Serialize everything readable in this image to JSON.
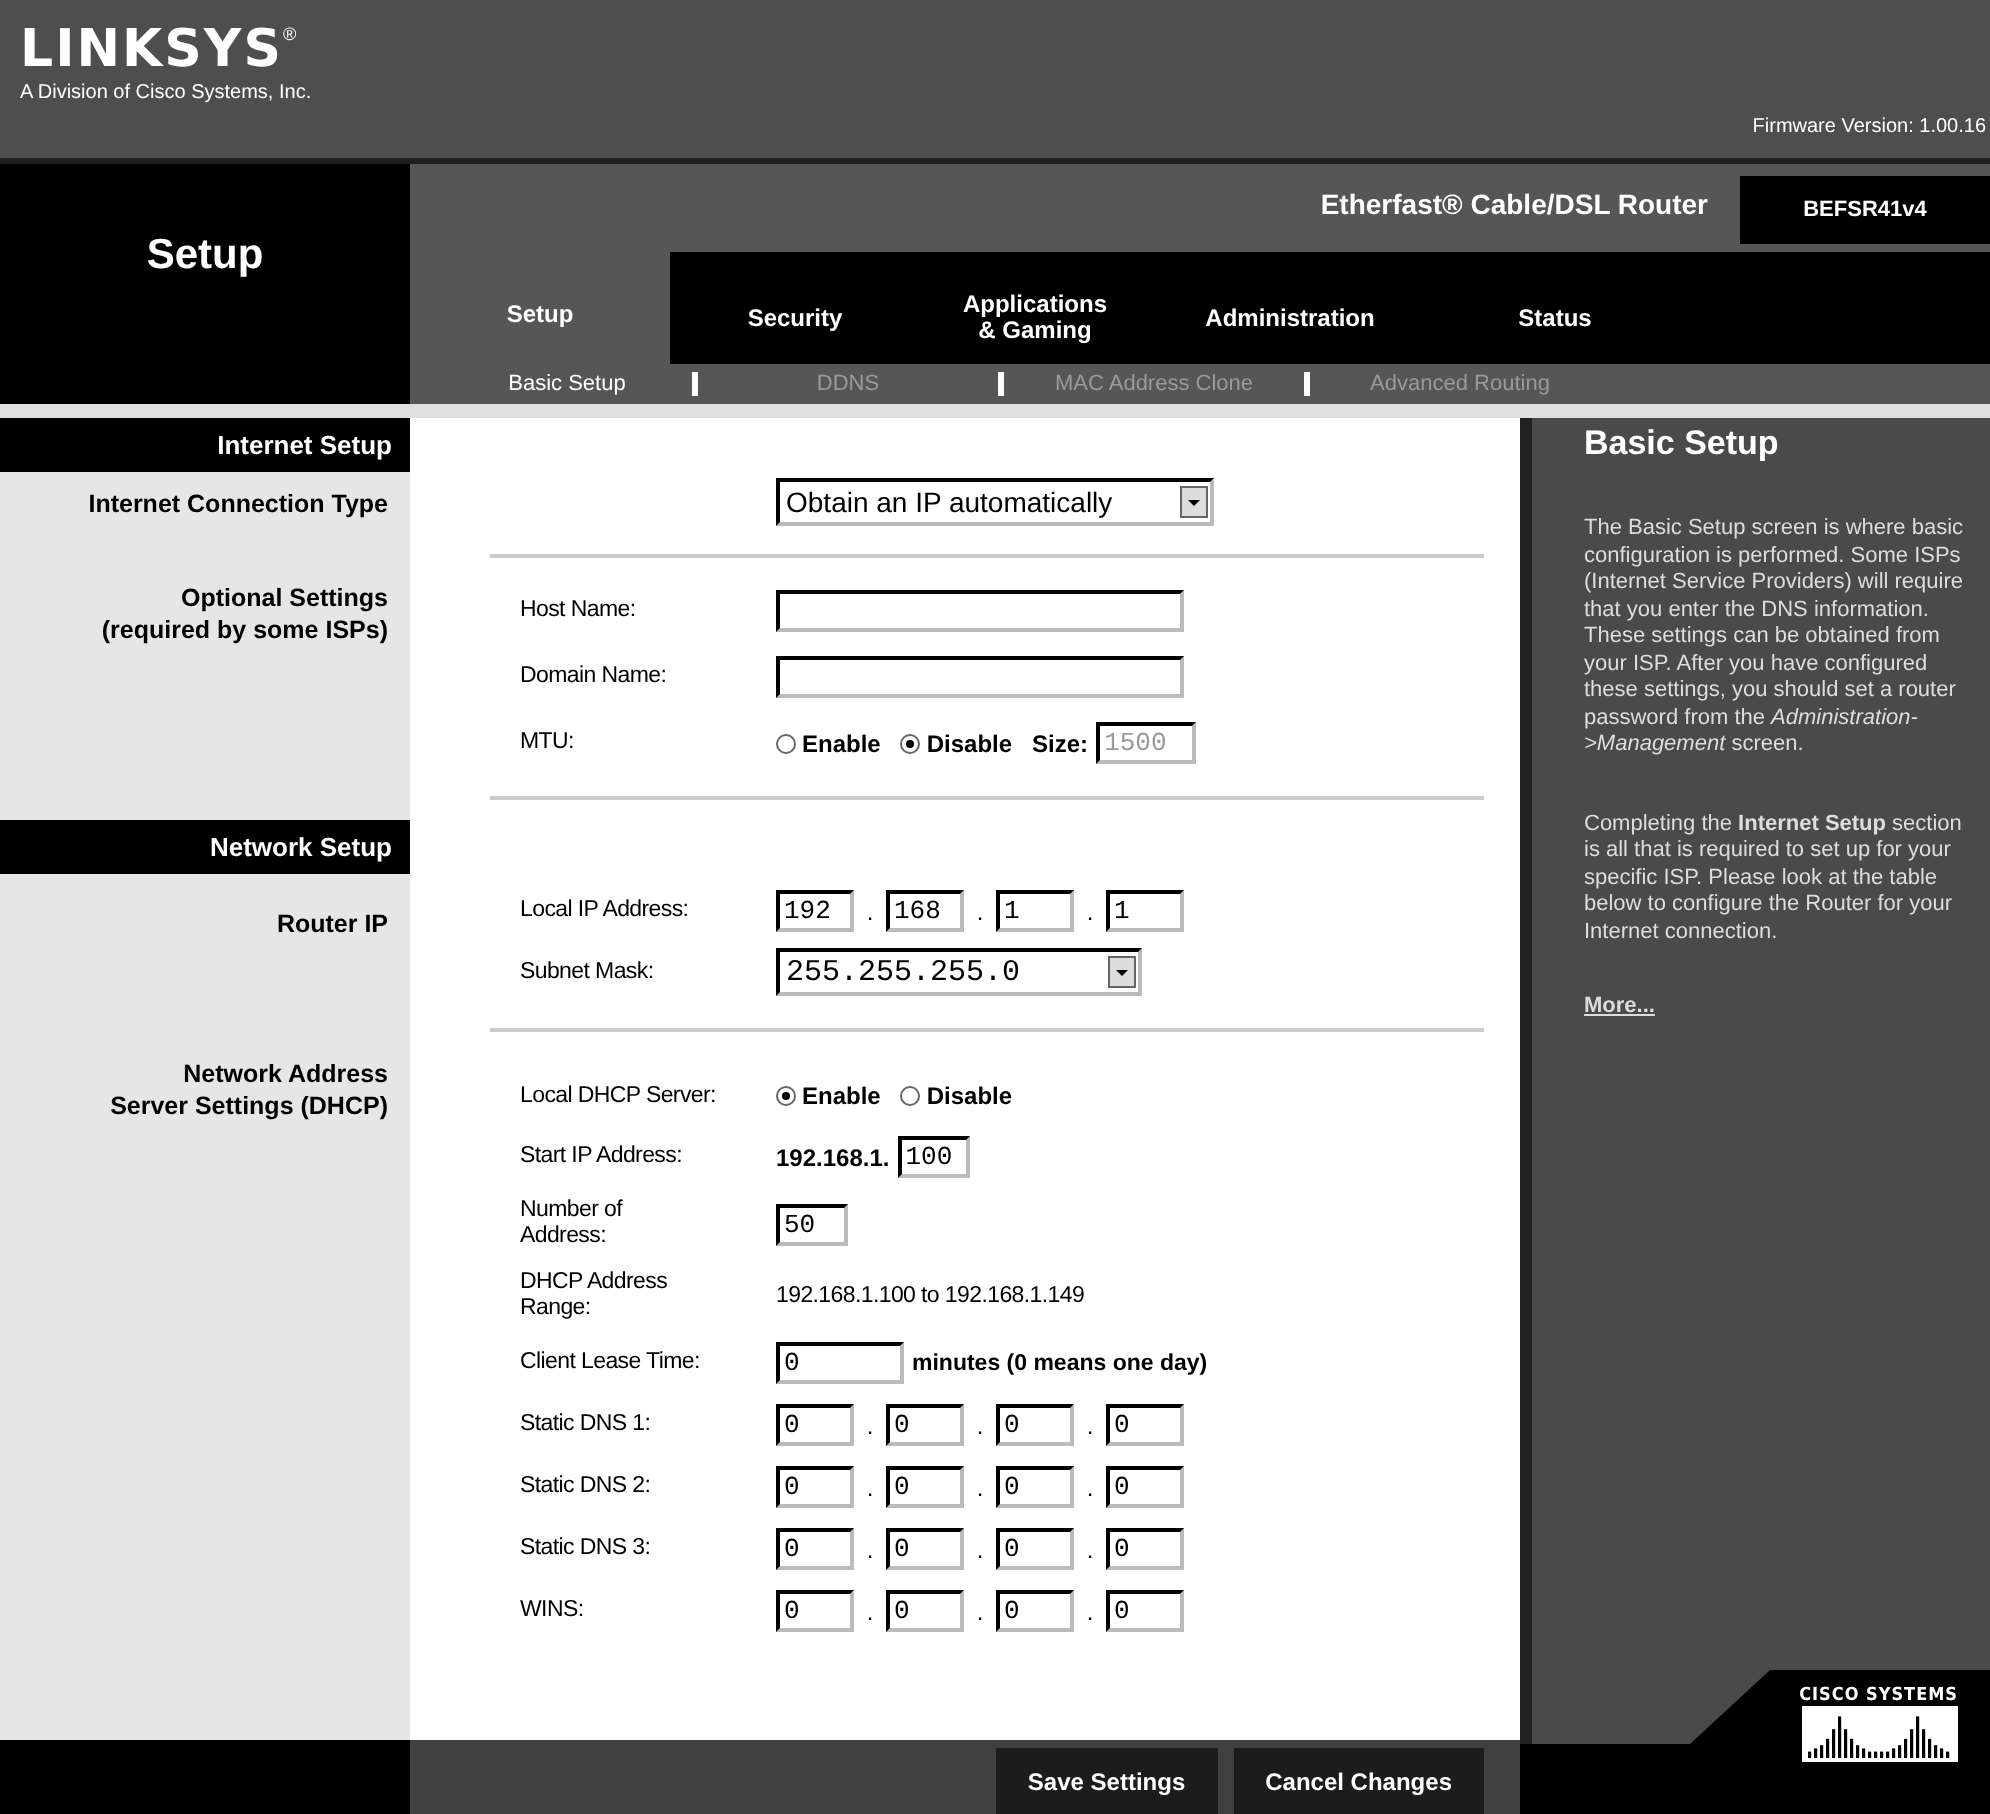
{
  "header": {
    "brand": "LINKSYS",
    "brand_mark": "®",
    "tagline": "A Division of Cisco Systems, Inc.",
    "firmware": "Firmware Version: 1.00.16"
  },
  "page_title": "Setup",
  "product": {
    "name": "Etherfast® Cable/DSL Router",
    "model": "BEFSR41v4"
  },
  "tabs": [
    {
      "label": "Setup",
      "selected": true
    },
    {
      "label": "Security",
      "selected": false
    },
    {
      "label": "Applications\n& Gaming",
      "selected": false
    },
    {
      "label": "Administration",
      "selected": false
    },
    {
      "label": "Status",
      "selected": false
    }
  ],
  "subtabs": [
    {
      "label": "Basic Setup",
      "selected": true
    },
    {
      "label": "DDNS",
      "selected": false
    },
    {
      "label": "MAC Address Clone",
      "selected": false
    },
    {
      "label": "Advanced Routing",
      "selected": false
    }
  ],
  "sections": [
    {
      "heading": "Internet Setup",
      "groups": [
        {
          "label": "Internet Connection Type",
          "fields": [
            {
              "kind": "select",
              "value": "Obtain an IP automatically"
            }
          ]
        },
        {
          "label": "Optional Settings\n(required by some ISPs)",
          "fields": [
            {
              "kind": "text",
              "label": "Host Name:"
            },
            {
              "kind": "text",
              "label": "Domain Name:"
            },
            {
              "kind": "mtu",
              "label": "MTU:",
              "options": [
                {
                  "label": "Enable",
                  "selected": false
                },
                {
                  "label": "Disable",
                  "selected": true
                }
              ],
              "size_label": "Size:",
              "size_value": "1500",
              "size_disabled": true
            }
          ]
        }
      ]
    },
    {
      "heading": "Network Setup",
      "groups": [
        {
          "label": "Router IP",
          "fields": [
            {
              "kind": "ip",
              "label": "Local IP Address:",
              "octets": [
                "192",
                "168",
                "1",
                "1"
              ],
              "separator": "."
            },
            {
              "kind": "select",
              "label": "Subnet Mask:",
              "value": "255.255.255.0"
            }
          ]
        },
        {
          "label": "Network Address\nServer Settings (DHCP)",
          "fields": [
            {
              "kind": "radio",
              "label": "Local DHCP Server:",
              "options": [
                {
                  "label": "Enable",
                  "selected": true
                },
                {
                  "label": "Disable",
                  "selected": false
                }
              ]
            },
            {
              "kind": "prefixed",
              "label": "Start IP Address:",
              "prefix": "192.168.1.",
              "value": "100"
            },
            {
              "kind": "short",
              "label": "Number  of\nAddress:",
              "value": "50"
            },
            {
              "kind": "static",
              "label": "DHCP  Address\nRange:",
              "value": "192.168.1.100 to 192.168.1.149"
            },
            {
              "kind": "text",
              "label": "Client Lease Time:",
              "value": "0",
              "note": "minutes (0 means one day)"
            },
            {
              "kind": "ip",
              "label": "Static DNS 1:",
              "octets": [
                "0",
                "0",
                "0",
                "0"
              ],
              "separator": "."
            },
            {
              "kind": "ip",
              "label": "Static DNS 2:",
              "octets": [
                "0",
                "0",
                "0",
                "0"
              ],
              "separator": "."
            },
            {
              "kind": "ip",
              "label": "Static DNS 3:",
              "octets": [
                "0",
                "0",
                "0",
                "0"
              ],
              "separator": "."
            },
            {
              "kind": "ip",
              "label": "WINS:",
              "octets": [
                "0",
                "0",
                "0",
                "0"
              ],
              "separator": "."
            }
          ]
        }
      ]
    }
  ],
  "help": {
    "title": "Basic Setup",
    "paragraphs": [
      "The Basic Setup screen is where basic configuration is performed. Some ISPs (Internet Service Providers) will require that you enter the DNS information. These settings can be obtained from your ISP. After you have configured these settings, you should set a router password from the *Administration->Management* screen.",
      "Completing the **Internet Setup** section is all that is required to set up for your specific ISP. Please look at the table below to configure the Router for your Internet connection."
    ],
    "link": "More..."
  },
  "vendor": "CISCO SYSTEMS",
  "buttons": [
    "Save Settings",
    "Cancel Changes"
  ]
}
